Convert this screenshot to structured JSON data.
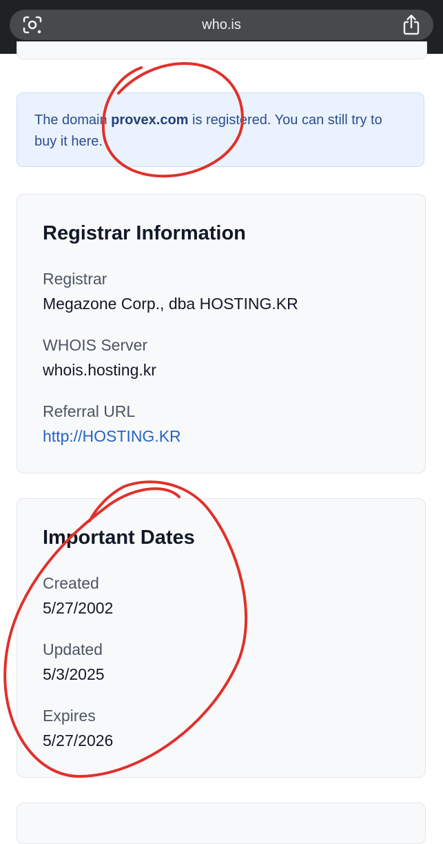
{
  "browser": {
    "url": "who.is",
    "lens_icon": "camera-lens-icon",
    "share_icon": "share-icon"
  },
  "notice": {
    "prefix": "The domain ",
    "domain": "provex.com",
    "middle": " is registered. You can still try to buy it ",
    "link": "here",
    "suffix": "."
  },
  "registrar_info": {
    "title": "Registrar Information",
    "registrar_label": "Registrar",
    "registrar_value": "Megazone Corp., dba HOSTING.KR",
    "whois_label": "WHOIS Server",
    "whois_value": "whois.hosting.kr",
    "referral_label": "Referral URL",
    "referral_value": "http://HOSTING.KR"
  },
  "important_dates": {
    "title": "Important Dates",
    "created_label": "Created",
    "created_value": "5/27/2002",
    "updated_label": "Updated",
    "updated_value": "5/3/2025",
    "expires_label": "Expires",
    "expires_value": "5/27/2026"
  },
  "colors": {
    "annotation": "#e0312b",
    "link": "#2563c4",
    "notice_bg": "#eaf2fd"
  }
}
